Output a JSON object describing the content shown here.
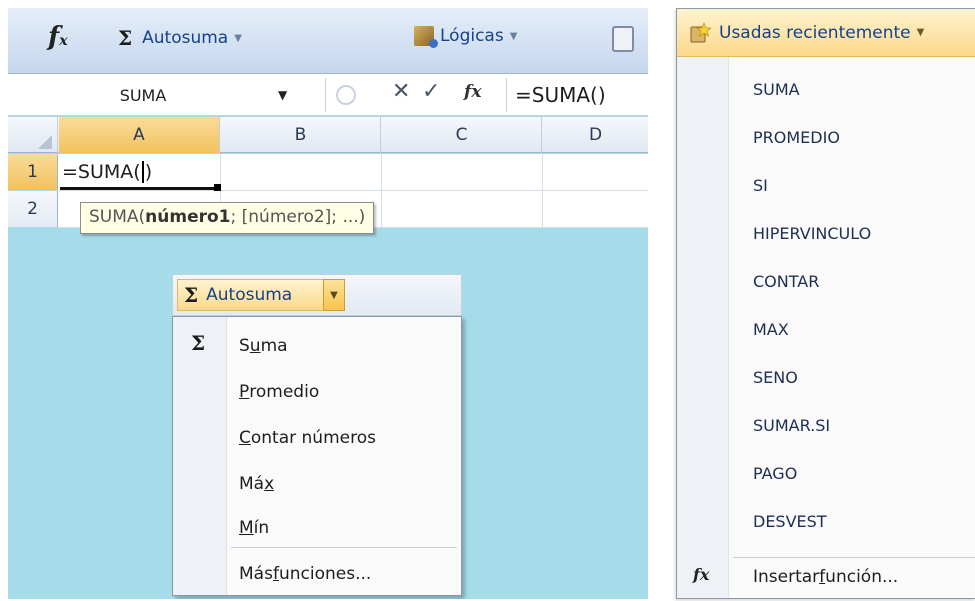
{
  "ribbon": {
    "insert_function_icon": "fx-icon",
    "autosum_label": "Autosuma",
    "logicas_label": "Lógicas",
    "lookup_icon": "lookup-icon"
  },
  "formula_bar": {
    "name_box": "SUMA",
    "formula": "=SUMA()"
  },
  "grid": {
    "columns": [
      "A",
      "B",
      "C",
      "D"
    ],
    "rows": [
      "1",
      "2"
    ],
    "active_cell_text": "=SUMA(",
    "active_cell_close": ")",
    "tooltip_prefix": "SUMA(",
    "tooltip_bold": "número1",
    "tooltip_rest": "; [número2]; ...)"
  },
  "autosum_menu": {
    "button_label": "Autosuma",
    "items": [
      {
        "pre": "S",
        "ul": "u",
        "post": "ma"
      },
      {
        "pre": "",
        "ul": "P",
        "post": "romedio"
      },
      {
        "pre": "",
        "ul": "C",
        "post": "ontar números"
      },
      {
        "pre": "Má",
        "ul": "x",
        "post": ""
      },
      {
        "pre": "",
        "ul": "M",
        "post": "ín"
      }
    ],
    "more_pre": "Más ",
    "more_ul": "f",
    "more_post": "unciones..."
  },
  "recent_menu": {
    "button_label": "Usadas recientemente",
    "items": [
      "SUMA",
      "PROMEDIO",
      "SI",
      "HIPERVINCULO",
      "CONTAR",
      "MAX",
      "SENO",
      "SUMAR.SI",
      "PAGO",
      "DESVEST"
    ],
    "insert_pre": "Insertar ",
    "insert_ul": "f",
    "insert_post": "unción..."
  },
  "colors": {
    "accent_orange": "#fbd98a",
    "ribbon_blue": "#15428b",
    "background_teal": "#a6dcea"
  }
}
